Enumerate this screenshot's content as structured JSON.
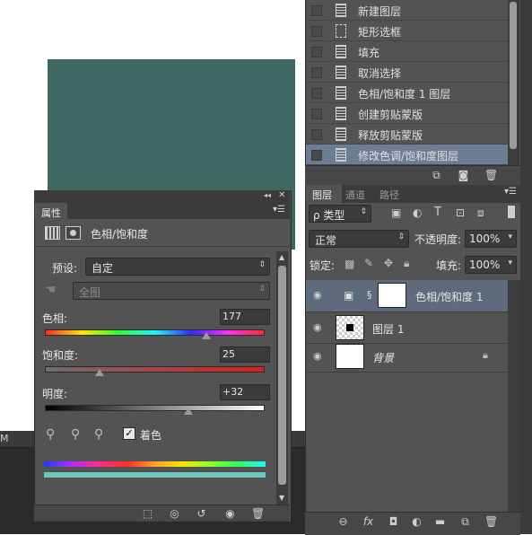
{
  "history": {
    "items": [
      {
        "label": "新建图层",
        "icon": "document-icon"
      },
      {
        "label": "矩形选框",
        "icon": "marquee-icon"
      },
      {
        "label": "填充",
        "icon": "fill-icon"
      },
      {
        "label": "取消选择",
        "icon": "document-icon"
      },
      {
        "label": "色相/饱和度 1 图层",
        "icon": "document-icon"
      },
      {
        "label": "创建剪贴蒙版",
        "icon": "document-icon"
      },
      {
        "label": "释放剪贴蒙版",
        "icon": "document-icon"
      },
      {
        "label": "修改色调/饱和度图层",
        "icon": "document-icon",
        "selected": true
      }
    ]
  },
  "layers": {
    "tabs": [
      "图层",
      "通道",
      "路径"
    ],
    "filter_label": "ρ 类型",
    "blend_mode": "正常",
    "opacity_label": "不透明度:",
    "opacity_value": "100%",
    "lock_label": "锁定:",
    "fill_label": "填充:",
    "fill_value": "100%",
    "rows": [
      {
        "name": "色相/饱和度 1",
        "selected": true
      },
      {
        "name": "图层 1"
      },
      {
        "name": "背景",
        "locked": true
      }
    ]
  },
  "properties": {
    "tab_label": "属性",
    "panel_title": "色相/饱和度",
    "preset_label": "预设:",
    "preset_value": "自定",
    "channel_value": "全图",
    "hue_label": "色相:",
    "hue_value": "177",
    "hue_level": 0.74,
    "saturation_label": "饱和度:",
    "saturation_value": "25",
    "saturation_level": 0.25,
    "lightness_label": "明度:",
    "lightness_value": "+32",
    "lightness_level": 0.66,
    "colorize_label": "着色",
    "colorize_checked": true
  },
  "status": {
    "text": "M"
  },
  "colors": {
    "canvas_fill": "#3f6863",
    "selection": "#6c7e96",
    "panel": "#535353"
  }
}
